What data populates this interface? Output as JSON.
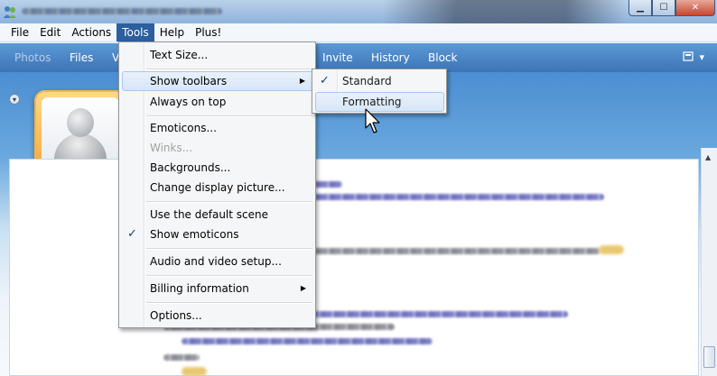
{
  "menubar": {
    "items": [
      {
        "label": "File"
      },
      {
        "label": "Edit"
      },
      {
        "label": "Actions"
      },
      {
        "label": "Tools"
      },
      {
        "label": "Help"
      },
      {
        "label": "Plus!"
      }
    ]
  },
  "toolbar": {
    "items": [
      {
        "label": "Photos",
        "dimmed": true
      },
      {
        "label": "Files",
        "dimmed": false
      },
      {
        "label": "V",
        "dimmed": false
      },
      {
        "label": "Invite",
        "dimmed": false
      },
      {
        "label": "History",
        "dimmed": false
      },
      {
        "label": "Block",
        "dimmed": false
      }
    ]
  },
  "tools_menu": {
    "items": [
      {
        "label": "Text Size..."
      },
      {
        "label": "Show toolbars",
        "has_submenu": true
      },
      {
        "label": "Always on top"
      },
      {
        "label": "Emoticons..."
      },
      {
        "label": "Winks...",
        "disabled": true
      },
      {
        "label": "Backgrounds..."
      },
      {
        "label": "Change display picture..."
      },
      {
        "label": "Use the default scene"
      },
      {
        "label": "Show emoticons",
        "checked": true
      },
      {
        "label": "Audio and video setup..."
      },
      {
        "label": "Billing information",
        "has_submenu": true
      },
      {
        "label": "Options..."
      }
    ]
  },
  "toolbars_submenu": {
    "items": [
      {
        "label": "Standard",
        "checked": true
      },
      {
        "label": "Formatting",
        "highlighted": true
      }
    ]
  },
  "colors": {
    "menu_active": "#2c5f9e",
    "toolbar_blue": "#4b86c6",
    "avatar_frame": "#f3a12a",
    "highlight_border": "#a8c8ee"
  }
}
